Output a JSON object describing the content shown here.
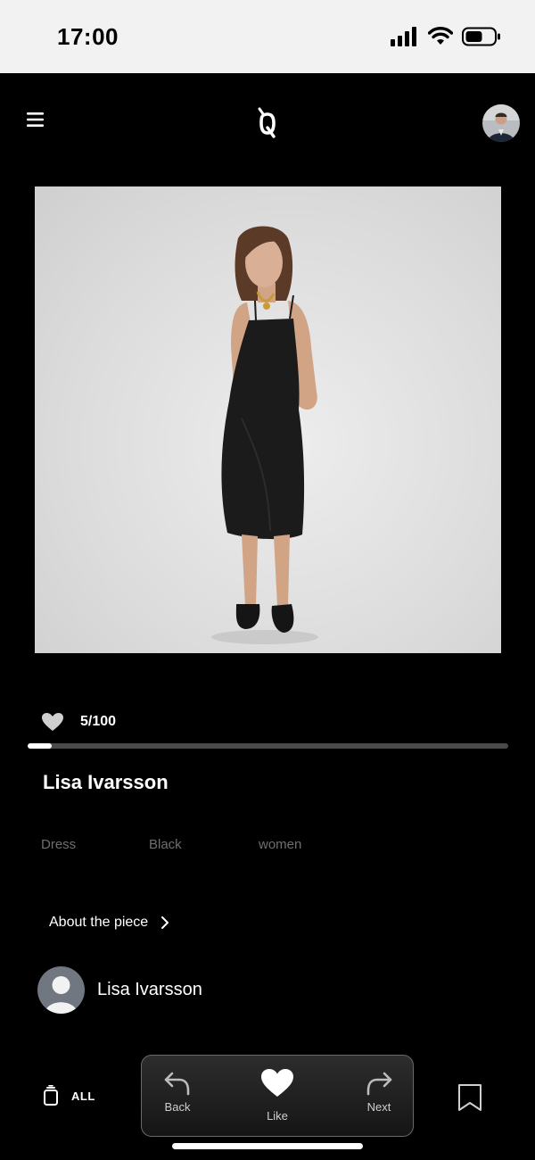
{
  "status_bar": {
    "time": "17:00"
  },
  "product": {
    "likes": "5/100",
    "like_progress": 0.05,
    "designer_name": "Lisa Ivarsson",
    "tags": [
      "Dress",
      "Black",
      "women"
    ],
    "about_label": "About the piece"
  },
  "creator": {
    "name": "Lisa Ivarsson"
  },
  "bottom_nav": {
    "all_label": "ALL",
    "back_label": "Back",
    "like_label": "Like",
    "next_label": "Next"
  },
  "colors": {
    "background": "#000000",
    "status_bar": "#f2f2f2",
    "tag_text": "#6f6f6f",
    "progress_track": "#4a4a4a"
  }
}
